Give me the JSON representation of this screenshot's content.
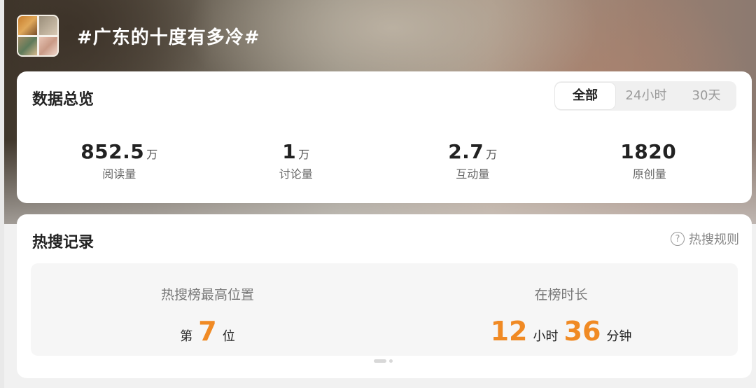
{
  "topic": {
    "title": "#广东的十度有多冷#"
  },
  "overview": {
    "title": "数据总览",
    "tabs": [
      {
        "label": "全部",
        "active": true
      },
      {
        "label": "24小时",
        "active": false
      },
      {
        "label": "30天",
        "active": false
      }
    ],
    "stats": [
      {
        "value": "852.5",
        "unit": "万",
        "label": "阅读量"
      },
      {
        "value": "1",
        "unit": "万",
        "label": "讨论量"
      },
      {
        "value": "2.7",
        "unit": "万",
        "label": "互动量"
      },
      {
        "value": "1820",
        "unit": "",
        "label": "原创量"
      }
    ]
  },
  "hot": {
    "title": "热搜记录",
    "rules_label": "热搜规则",
    "rules_icon": "question-circle-icon",
    "best_position": {
      "label": "热搜榜最高位置",
      "prefix": "第",
      "value": "7",
      "suffix": "位"
    },
    "duration": {
      "label": "在榜时长",
      "hours": "12",
      "hours_unit": "小时",
      "minutes": "36",
      "minutes_unit": "分钟"
    }
  },
  "colors": {
    "accent": "#f08a24",
    "card_bg": "#ffffff",
    "page_bg": "#f1f1f1"
  }
}
